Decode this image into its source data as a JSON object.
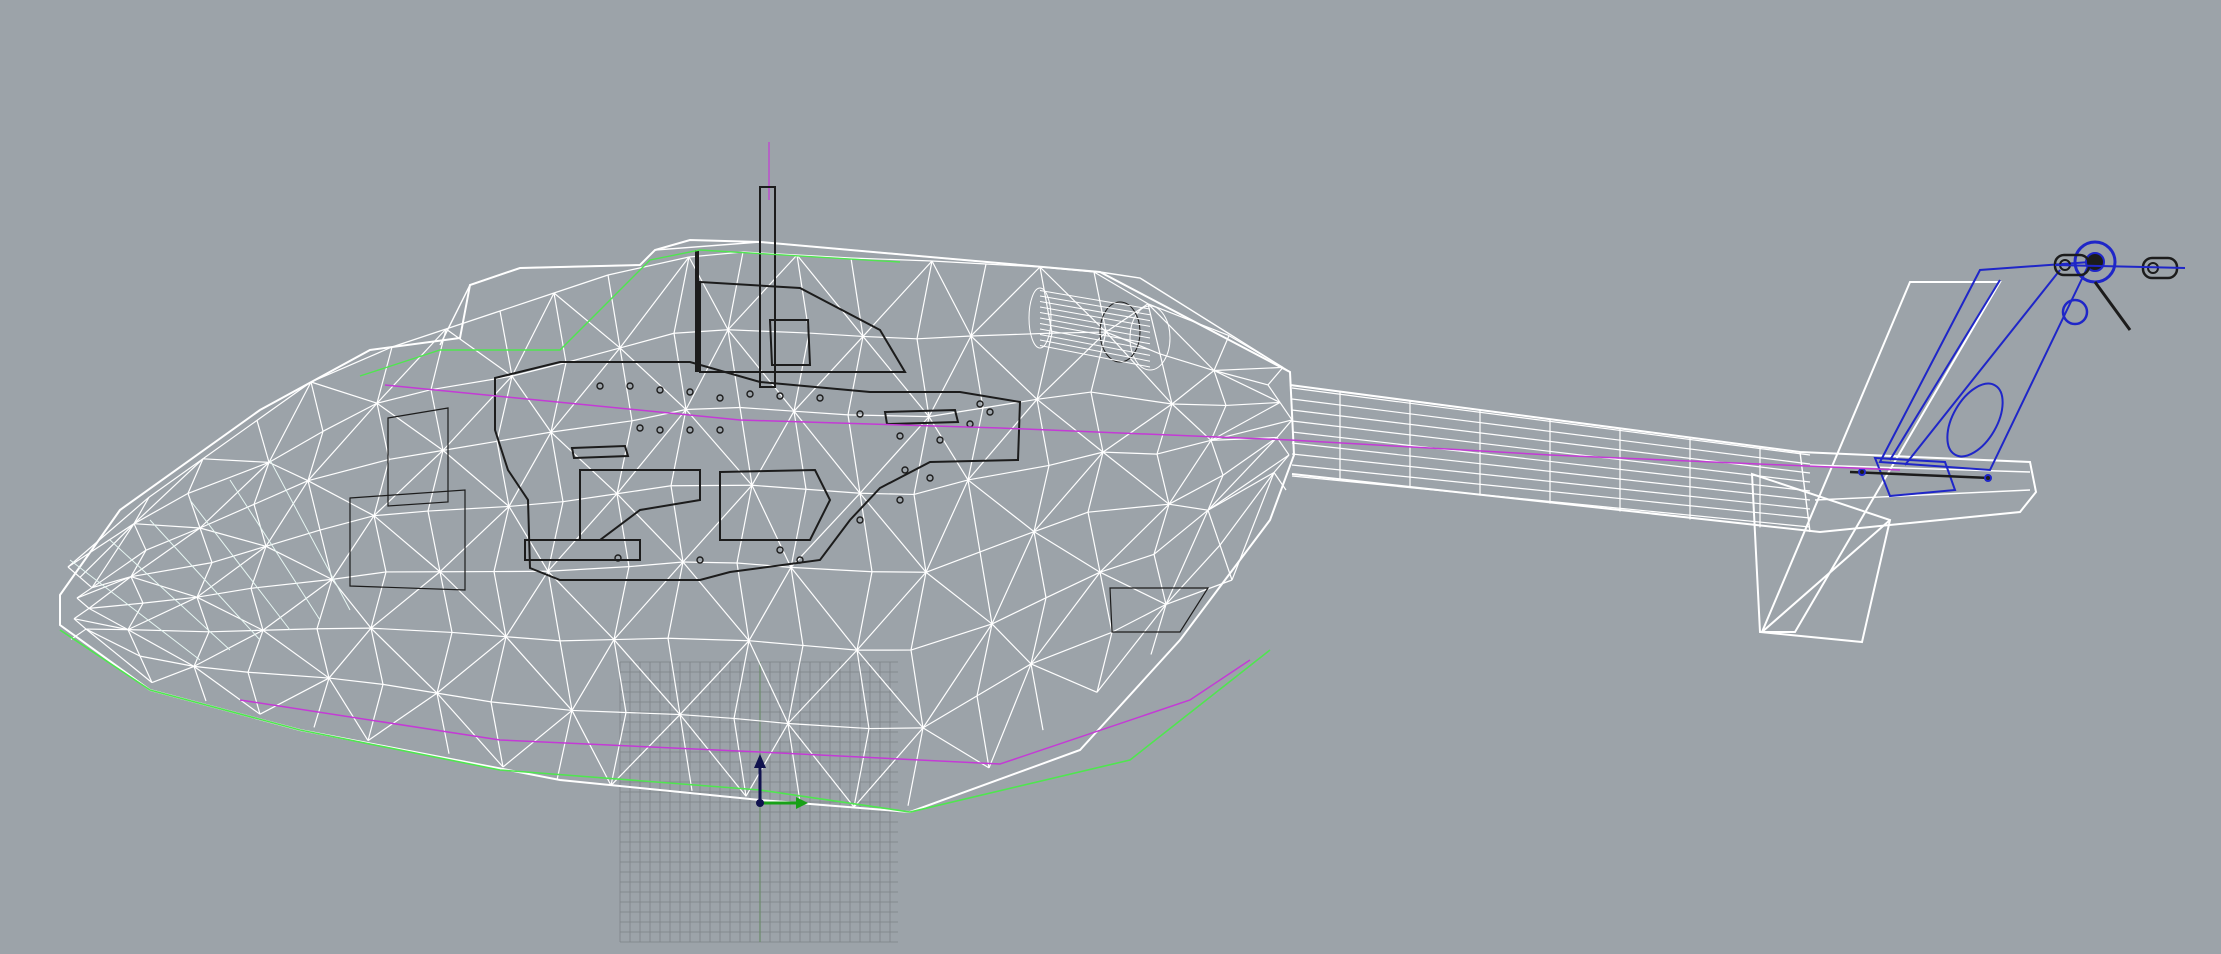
{
  "viewport": {
    "mode": "wireframe",
    "background_color": "#9ca3a9"
  },
  "colors": {
    "mesh_edges": "#ffffff",
    "mesh_edges_tint": "#e6f6f2",
    "internal_frame": "#1c1c1c",
    "tail_rotor_assembly": "#1f26c8",
    "curve_magenta": "#c43ad6",
    "outline_green": "#4fe64f",
    "construction_grid": "#7e8388",
    "axis_z": "#10124e",
    "axis_x": "#18a018"
  },
  "objects": [
    {
      "name": "fuselage-shell",
      "icon": "mesh-icon"
    },
    {
      "name": "tail-boom",
      "icon": "mesh-icon"
    },
    {
      "name": "vertical-fin",
      "icon": "mesh-icon"
    },
    {
      "name": "internal-frame",
      "icon": "frame-icon"
    },
    {
      "name": "engine-cylinder",
      "icon": "cylinder-icon"
    },
    {
      "name": "tail-rotor",
      "icon": "rotor-icon"
    },
    {
      "name": "main-rotor-shaft",
      "icon": "shaft-icon"
    }
  ],
  "gizmo": {
    "icon": "axis-gizmo-icon",
    "axes": [
      "z",
      "x"
    ]
  }
}
